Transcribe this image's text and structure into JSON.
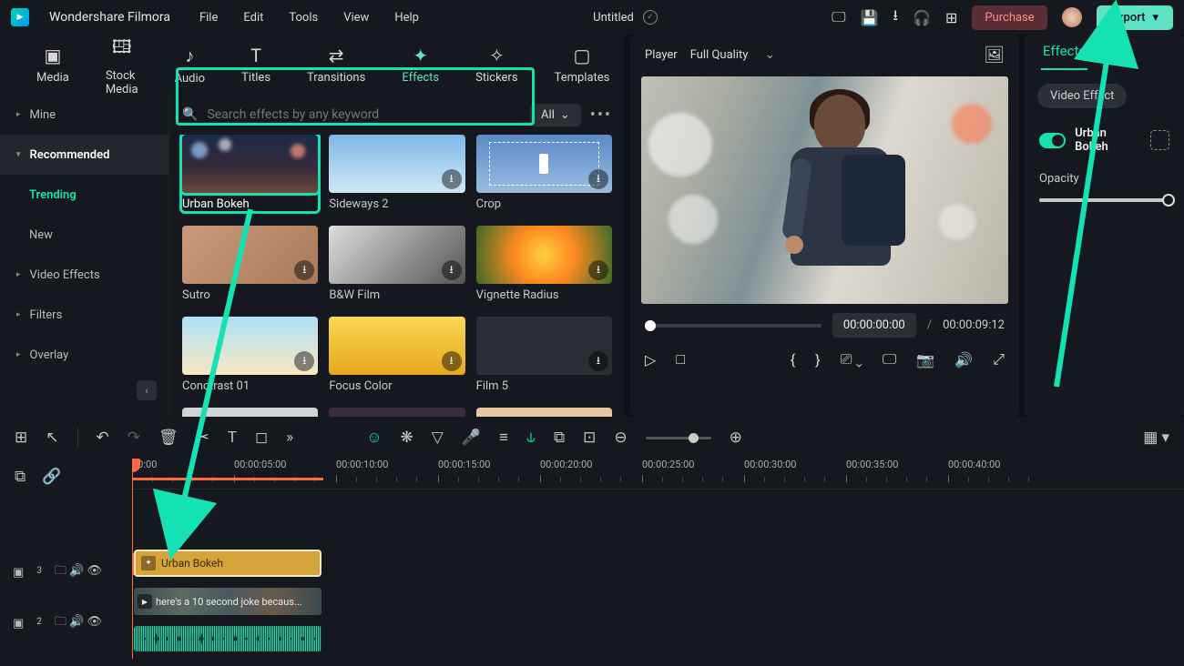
{
  "app": {
    "title": "Wondershare Filmora"
  },
  "menu": [
    "File",
    "Edit",
    "Tools",
    "View",
    "Help"
  ],
  "doc": {
    "title": "Untitled"
  },
  "topbar_buttons": {
    "purchase": "Purchase",
    "export": "Export"
  },
  "main_tabs": [
    {
      "id": "media",
      "label": "Media"
    },
    {
      "id": "stock-media",
      "label": "Stock Media"
    },
    {
      "id": "audio",
      "label": "Audio"
    },
    {
      "id": "titles",
      "label": "Titles"
    },
    {
      "id": "transitions",
      "label": "Transitions"
    },
    {
      "id": "effects",
      "label": "Effects",
      "active": true
    },
    {
      "id": "stickers",
      "label": "Stickers"
    },
    {
      "id": "templates",
      "label": "Templates"
    }
  ],
  "sidebar": {
    "items": [
      {
        "label": "Mine"
      },
      {
        "label": "Recommended",
        "selected": true,
        "children": [
          {
            "label": "Trending",
            "active": true
          },
          {
            "label": "New"
          }
        ]
      },
      {
        "label": "Video Effects"
      },
      {
        "label": "Filters"
      },
      {
        "label": "Overlay"
      }
    ]
  },
  "search": {
    "placeholder": "Search effects by any keyword",
    "filter": "All"
  },
  "effects_grid": [
    {
      "label": "Urban Bokeh",
      "selected": true,
      "thumb": "bokeh"
    },
    {
      "label": "Sideways 2",
      "thumb": "sky",
      "dl": true
    },
    {
      "label": "Crop",
      "thumb": "crop",
      "dl": true
    },
    {
      "label": "Sutro",
      "thumb": "sutro",
      "dl": true
    },
    {
      "label": "B&W Film",
      "thumb": "bw",
      "dl": true
    },
    {
      "label": "Vignette Radius",
      "thumb": "flower",
      "dl": true
    },
    {
      "label": "Conctrast 01",
      "thumb": "light",
      "dl": true
    },
    {
      "label": "Focus Color",
      "thumb": "bus",
      "dl": true
    },
    {
      "label": "Film 5",
      "thumb": "dark",
      "dl": true
    }
  ],
  "player": {
    "title": "Player",
    "quality": "Full Quality",
    "time_current": "00:00:00:00",
    "time_total": "00:00:09:12"
  },
  "right_panel": {
    "tab": "Effects",
    "chip": "Video Effect",
    "effect_name": "Urban Bokeh",
    "opacity_label": "Opacity",
    "opacity": 100
  },
  "timeline": {
    "ruler": [
      "00:00",
      "00:00:05:00",
      "00:00:10:00",
      "00:00:15:00",
      "00:00:20:00",
      "00:00:25:00",
      "00:00:30:00",
      "00:00:35:00",
      "00:00:40:00"
    ],
    "tracks": [
      {
        "id": 3,
        "type": "fx",
        "clip": {
          "label": "Urban Bokeh",
          "start": 0,
          "len": 210
        }
      },
      {
        "id": 2,
        "type": "video",
        "clip": {
          "label": "here's a 10 second joke becaus...",
          "start": 0,
          "len": 210
        }
      }
    ]
  }
}
